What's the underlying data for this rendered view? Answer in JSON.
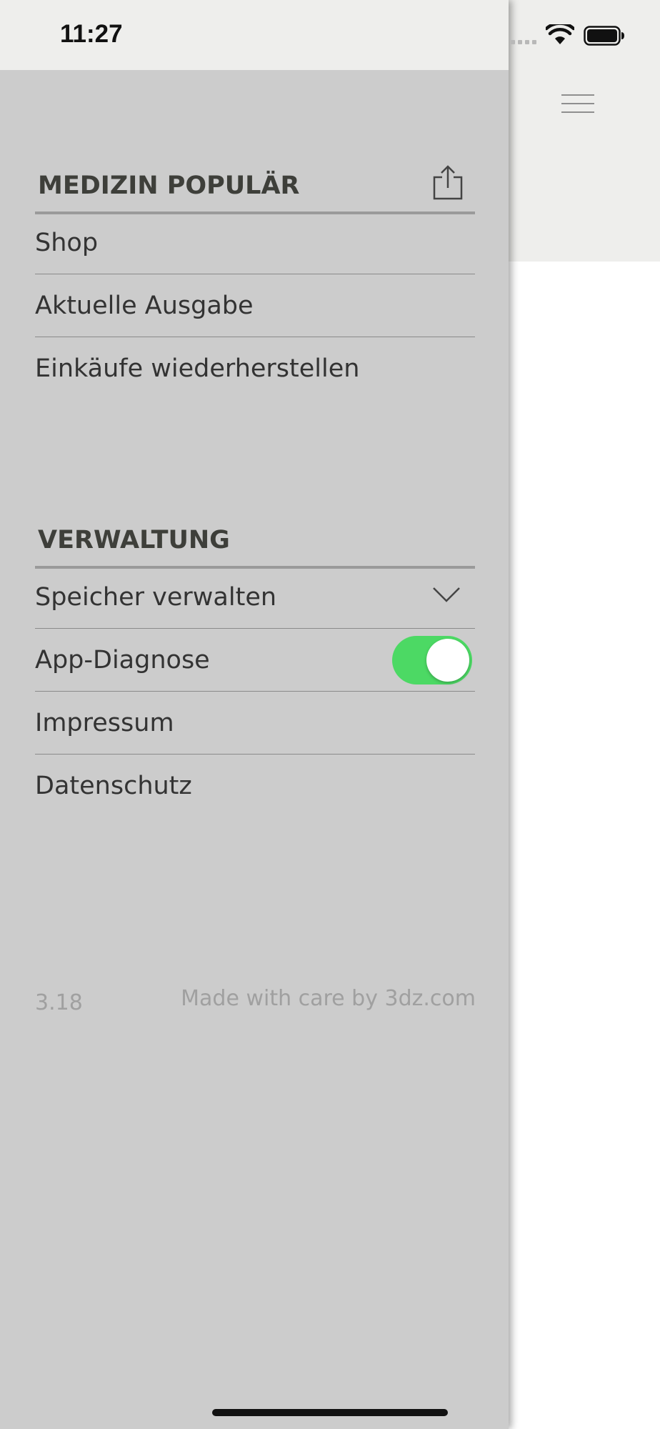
{
  "status_bar": {
    "time": "11:27"
  },
  "drawer": {
    "sections": [
      {
        "title": "MEDIZIN POPULÄR",
        "items": [
          {
            "label": "Shop"
          },
          {
            "label": "Aktuelle Ausgabe"
          },
          {
            "label": "Einkäufe wiederherstellen"
          }
        ]
      },
      {
        "title": "VERWALTUNG",
        "items": [
          {
            "label": "Speicher verwalten"
          },
          {
            "label": "App-Diagnose",
            "toggle_on": true
          },
          {
            "label": "Impressum"
          },
          {
            "label": "Datenschutz"
          }
        ]
      }
    ],
    "footer": {
      "version": "3.18",
      "credit": "Made with care by 3dz.com"
    }
  },
  "colors": {
    "drawer_bg": "#cccccc",
    "header_bg": "#eeeeec",
    "toggle_on": "#4cd964",
    "title_text": "#3e3f3a"
  },
  "icons": [
    "share-icon",
    "chevron-down-icon",
    "hamburger-menu-icon",
    "wifi-icon",
    "battery-icon"
  ]
}
